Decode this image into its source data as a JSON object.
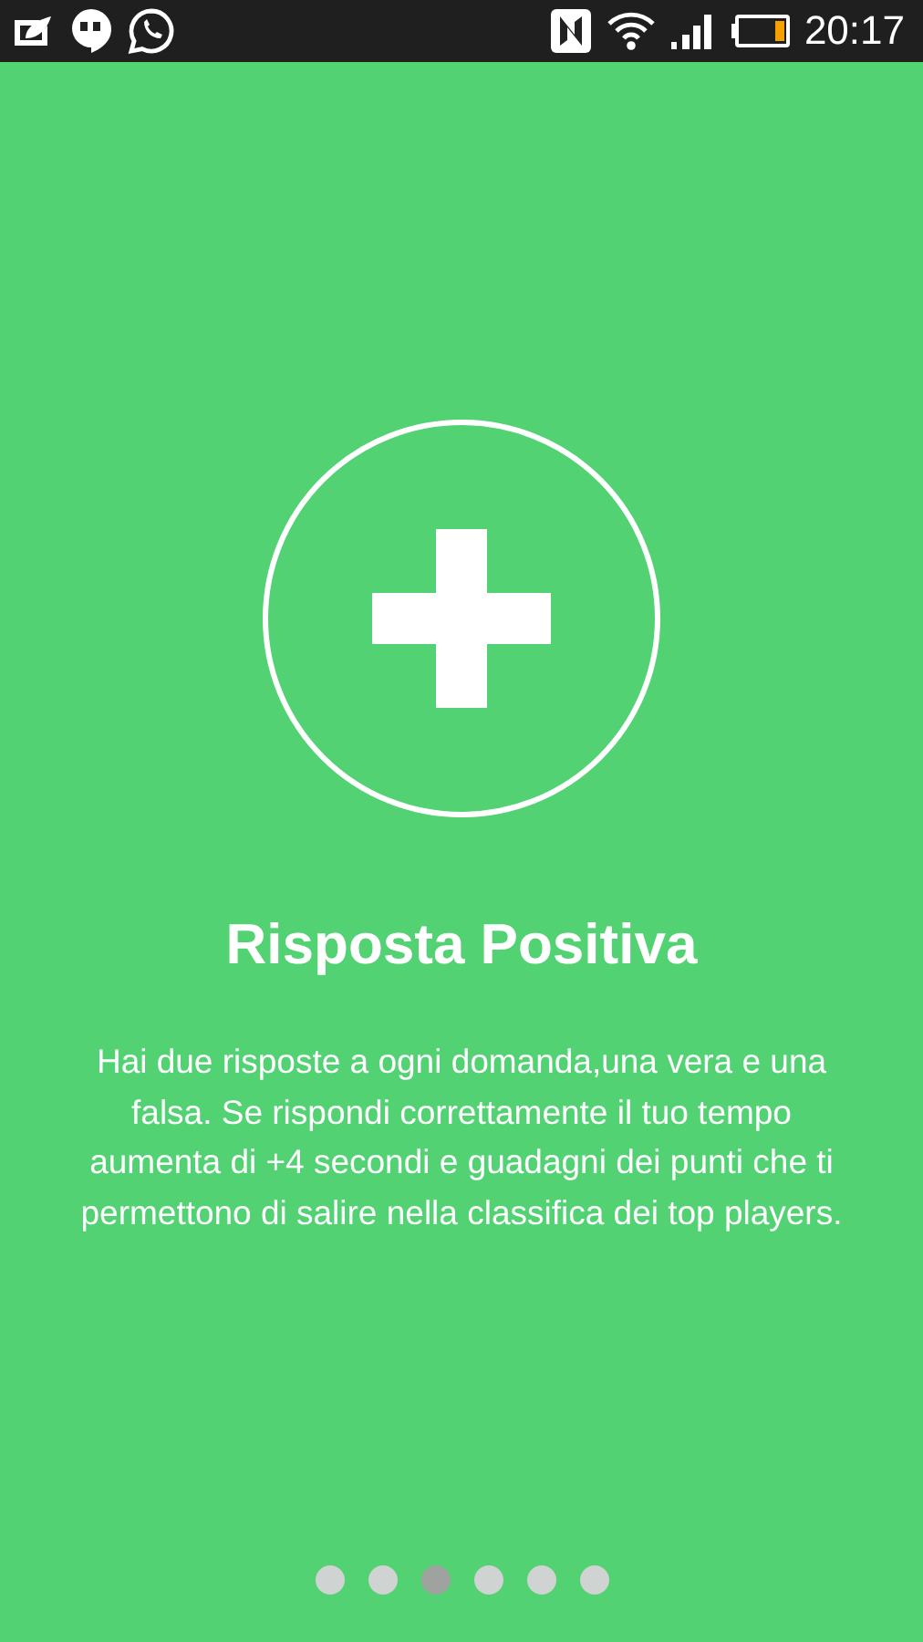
{
  "status_bar": {
    "time": "20:17"
  },
  "title": "Risposta Positiva",
  "description": "Hai due risposte a ogni domanda,una vera e una falsa. Se rispondi correttamente il tuo tempo aumenta di +4 secondi e guadagni dei punti che ti permettono di salire nella classifica dei top players.",
  "pages": [
    {
      "selected": false
    },
    {
      "selected": false
    },
    {
      "selected": true
    },
    {
      "selected": false
    },
    {
      "selected": false
    },
    {
      "selected": false
    }
  ]
}
